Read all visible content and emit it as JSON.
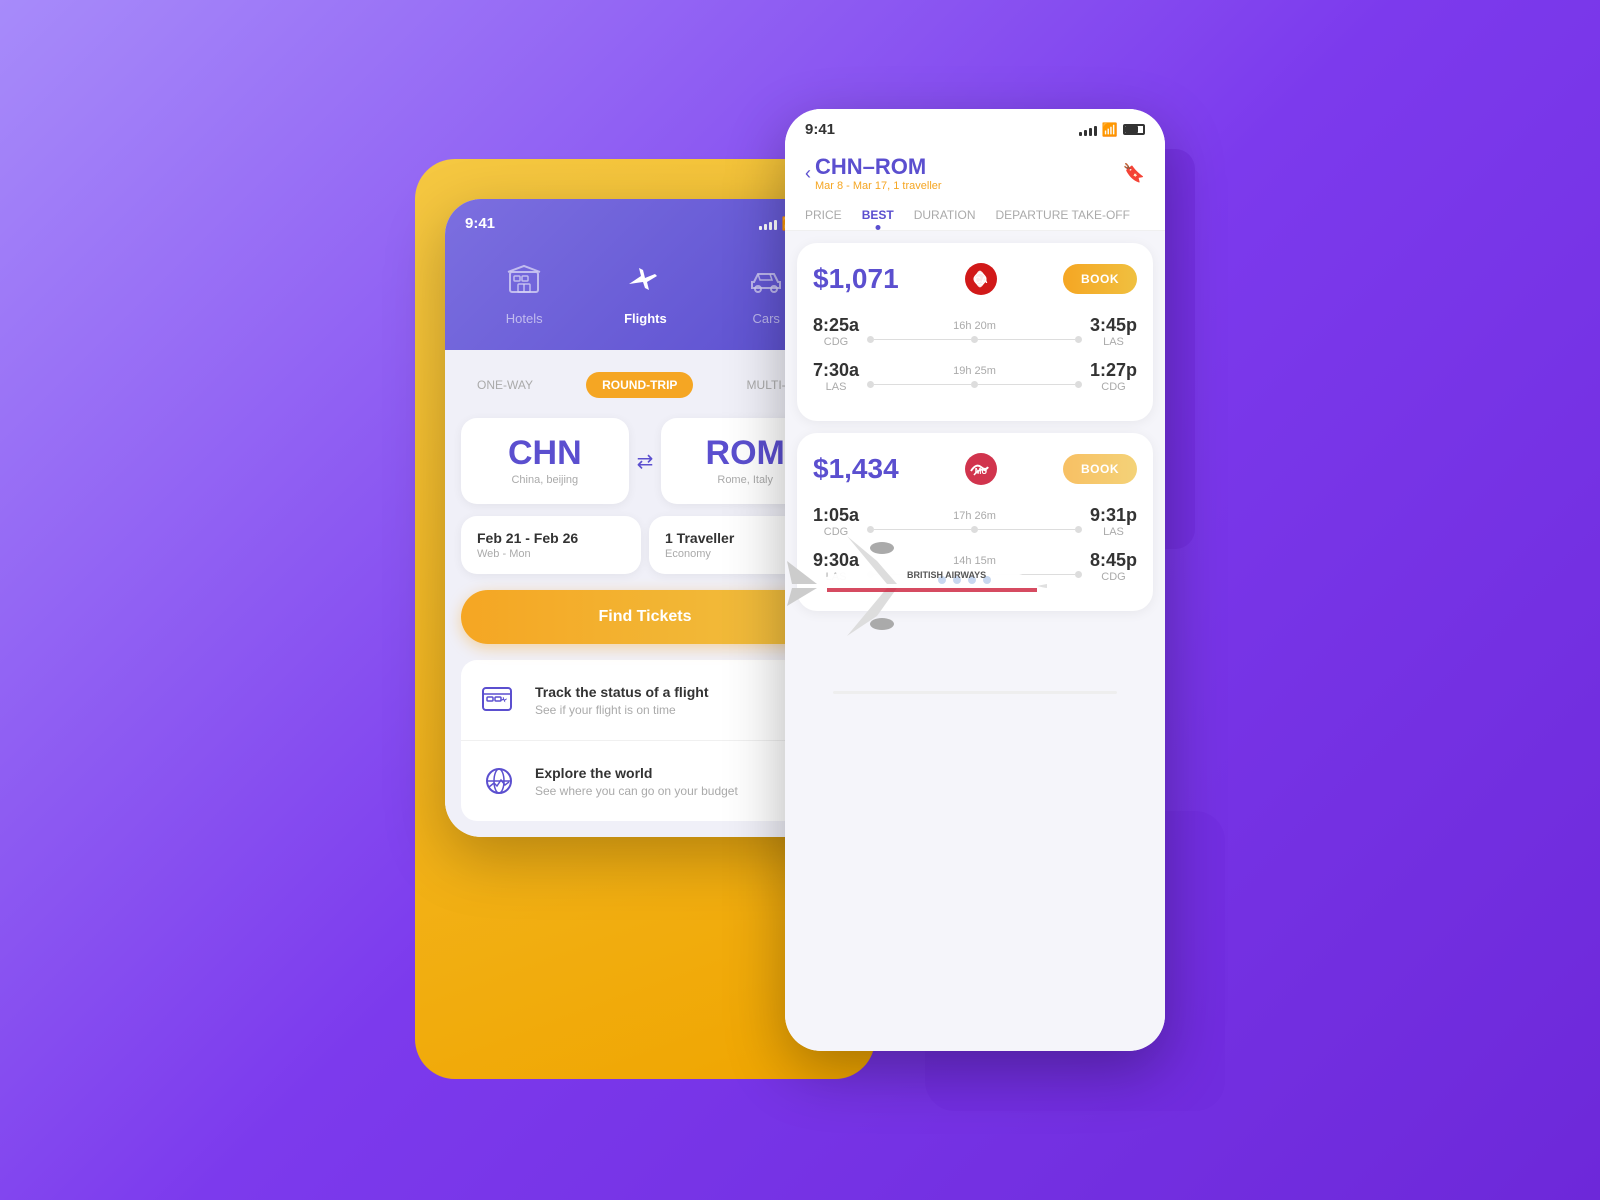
{
  "left_phone": {
    "status_bar": {
      "time": "9:41"
    },
    "nav": {
      "hotels_label": "Hotels",
      "flights_label": "Flights",
      "cars_label": "Cars"
    },
    "trip_types": {
      "one_way": "ONE-WAY",
      "round_trip": "ROUND-TRIP",
      "multi_city": "MULTI-CITY"
    },
    "origin": {
      "code": "CHN",
      "name": "China, beijing"
    },
    "destination": {
      "code": "ROM",
      "name": "Rome, Italy"
    },
    "dates": {
      "main": "Feb 21 - Feb 26",
      "sub": "Web - Mon"
    },
    "traveller": {
      "main": "1 Traveller",
      "sub": "Economy"
    },
    "find_tickets_btn": "Find Tickets",
    "features": [
      {
        "title": "Track the status of a flight",
        "subtitle": "See if your flight is on time"
      },
      {
        "title": "Explore the world",
        "subtitle": "See where you can go on your budget"
      }
    ]
  },
  "right_phone": {
    "status_bar": {
      "time": "9:41"
    },
    "header": {
      "route": "CHN–ROM",
      "dates": "Mar 8 - Mar 17, 1 traveller"
    },
    "sort_tabs": [
      "PRICE",
      "BEST",
      "DURATION",
      "DEPARTURE TAKE-OFF"
    ],
    "active_sort": "BEST",
    "flights": [
      {
        "price": "$1,071",
        "book_label": "BOOK",
        "airline": "Air China",
        "segments": [
          {
            "depart_time": "8:25a",
            "depart_airport": "CDG",
            "arrive_time": "3:45p",
            "arrive_airport": "LAS",
            "duration": "16h 20m"
          },
          {
            "depart_time": "7:30a",
            "depart_airport": "LAS",
            "arrive_time": "1:27p",
            "arrive_airport": "CDG",
            "duration": "19h 25m"
          }
        ]
      },
      {
        "price": "$1,434",
        "book_label": "BOOK",
        "airline": "China Eastern",
        "segments": [
          {
            "depart_time": "1:05a",
            "depart_airport": "CDG",
            "arrive_time": "9:31p",
            "arrive_airport": "LAS",
            "duration": "17h 26m"
          },
          {
            "depart_time": "9:30a",
            "depart_airport": "LAS",
            "arrive_time": "8:45p",
            "arrive_airport": "CDG",
            "duration": "14h 15m"
          }
        ]
      }
    ]
  },
  "colors": {
    "primary": "#5b4fcf",
    "accent": "#f5a623",
    "background": "#7c3aed"
  }
}
